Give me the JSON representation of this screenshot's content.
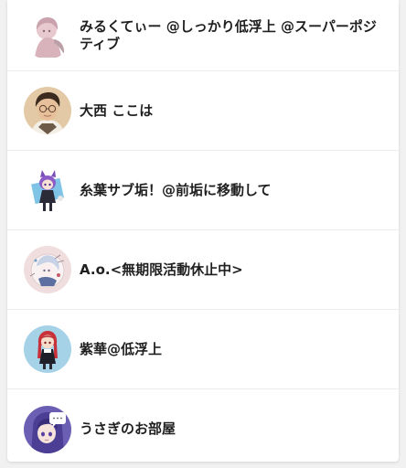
{
  "users": [
    {
      "name": "みるくてぃー @しっかり低浮上 @スーパーポジティブ",
      "avatar_icon": "pink-haired-girl-avatar",
      "avatar_bg": "#ffffff"
    },
    {
      "name": "大西 ここは",
      "avatar_icon": "man-with-glasses-avatar",
      "avatar_bg": "#e4c9a6"
    },
    {
      "name": "糸葉サブ垢！@前垢に移動して",
      "avatar_icon": "purple-cat-girl-avatar",
      "avatar_bg": "#ffffff"
    },
    {
      "name": "A.o.<無期限活動休止中>",
      "avatar_icon": "anime-sketch-avatar",
      "avatar_bg": "#f0dede"
    },
    {
      "name": "紫華@低浮上",
      "avatar_icon": "red-haired-girl-avatar",
      "avatar_bg": "#a6d2e8"
    },
    {
      "name": "うさぎのお部屋",
      "avatar_icon": "purple-haired-girl-avatar",
      "avatar_bg": "#6b5fb3"
    }
  ]
}
